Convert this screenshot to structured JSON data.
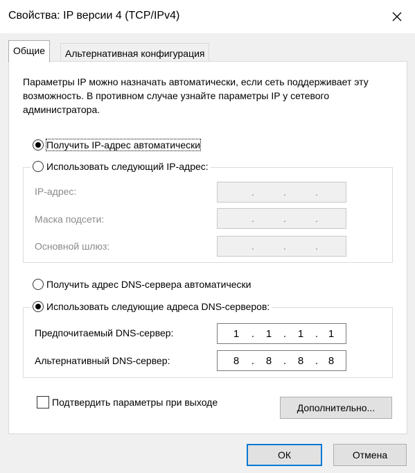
{
  "window": {
    "title": "Свойства: IP версии 4 (TCP/IPv4)",
    "close_glyph": "✕"
  },
  "tabs": [
    {
      "label": "Общие",
      "active": true
    },
    {
      "label": "Альтернативная конфигурация",
      "active": false
    }
  ],
  "general": {
    "description": "Параметры IP можно назначать автоматически, если сеть поддерживает эту возможность. В противном случае узнайте параметры IP у сетевого администратора.",
    "ip_auto": {
      "label": "Получить IP-адрес автоматически",
      "checked": true
    },
    "ip_manual": {
      "label": "Использовать следующий IP-адрес:",
      "checked": false
    },
    "ip_fields": [
      {
        "label": "IP-адрес:",
        "octets": [
          "",
          "",
          "",
          ""
        ],
        "enabled": false
      },
      {
        "label": "Маска подсети:",
        "octets": [
          "",
          "",
          "",
          ""
        ],
        "enabled": false
      },
      {
        "label": "Основной шлюз:",
        "octets": [
          "",
          "",
          "",
          ""
        ],
        "enabled": false
      }
    ],
    "dns_auto": {
      "label": "Получить адрес DNS-сервера автоматически",
      "checked": false
    },
    "dns_manual": {
      "label": "Использовать следующие адреса DNS-серверов:",
      "checked": true
    },
    "dns_fields": [
      {
        "label": "Предпочитаемый DNS-сервер:",
        "octets": [
          "1",
          "1",
          "1",
          "1"
        ],
        "enabled": true
      },
      {
        "label": "Альтернативный DNS-сервер:",
        "octets": [
          "8",
          "8",
          "8",
          "8"
        ],
        "enabled": true
      }
    ],
    "validate": {
      "label": "Подтвердить параметры при выходе",
      "checked": false
    },
    "advanced_button": "Дополнительно..."
  },
  "footer": {
    "ok_button": "ОК",
    "cancel_button": "Отмена"
  },
  "colors": {
    "dialog_bg": "#f0f0f0",
    "panel_bg": "#ffffff",
    "disabled_text": "#8a8a8a",
    "default_button_border": "#0078d7"
  }
}
